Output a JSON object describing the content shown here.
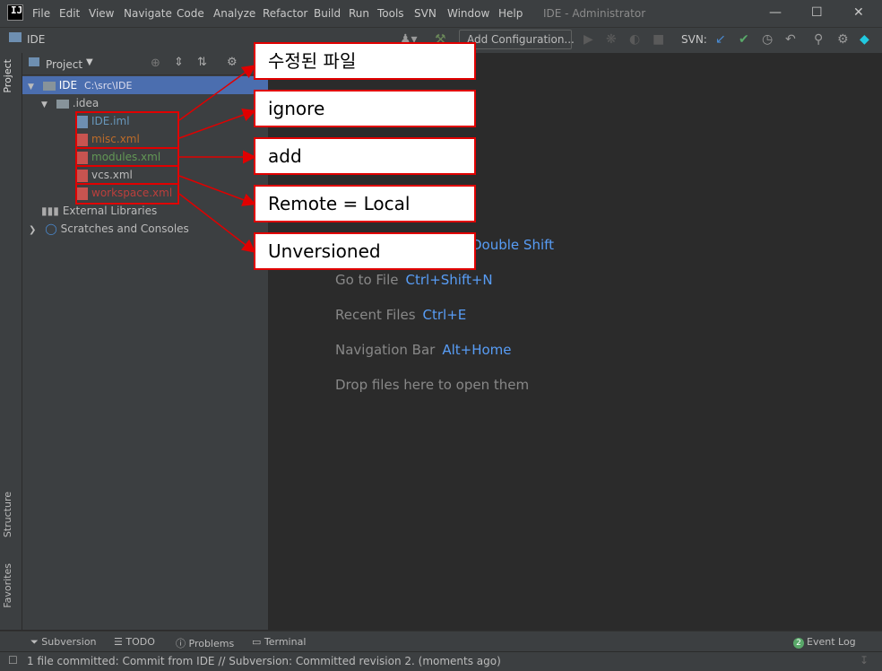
{
  "menu": [
    "File",
    "Edit",
    "View",
    "Navigate",
    "Code",
    "Analyze",
    "Refactor",
    "Build",
    "Run",
    "Tools",
    "SVN",
    "Window",
    "Help"
  ],
  "window_title": "IDE - Administrator",
  "toolbar": {
    "project_name": "IDE",
    "add_config_label": "Add Configuration...",
    "svn_label": "SVN:"
  },
  "left_tabs": [
    "Project",
    "Structure",
    "Favorites"
  ],
  "project_panel": {
    "title": "Project",
    "root": {
      "name": "IDE",
      "path": "C:\\src\\IDE"
    },
    "idea_folder": ".idea",
    "files": [
      {
        "name": "IDE.iml",
        "color": "#6897bb"
      },
      {
        "name": "misc.xml",
        "color": "#bc6b29"
      },
      {
        "name": "modules.xml",
        "color": "#629755"
      },
      {
        "name": "vcs.xml",
        "color": "#bbbbbb"
      },
      {
        "name": "workspace.xml",
        "color": "#bc3f3c"
      }
    ],
    "external_libraries": "External Libraries",
    "scratches": "Scratches and Consoles"
  },
  "editor_hints": [
    {
      "label": "",
      "key": "Double Shift"
    },
    {
      "label": "Go to File",
      "key": "Ctrl+Shift+N"
    },
    {
      "label": "Recent Files",
      "key": "Ctrl+E"
    },
    {
      "label": "Navigation Bar",
      "key": "Alt+Home"
    },
    {
      "label": "Drop files here to open them",
      "key": ""
    }
  ],
  "callouts": [
    "수정된 파일",
    "ignore",
    "add",
    "Remote = Local",
    "Unversioned"
  ],
  "bottom_tabs": [
    "Subversion",
    "TODO",
    "Problems",
    "Terminal"
  ],
  "event_log": {
    "count": "2",
    "label": "Event Log"
  },
  "status_text": "1 file committed: Commit from IDE // Subversion: Committed revision 2. (moments ago)"
}
